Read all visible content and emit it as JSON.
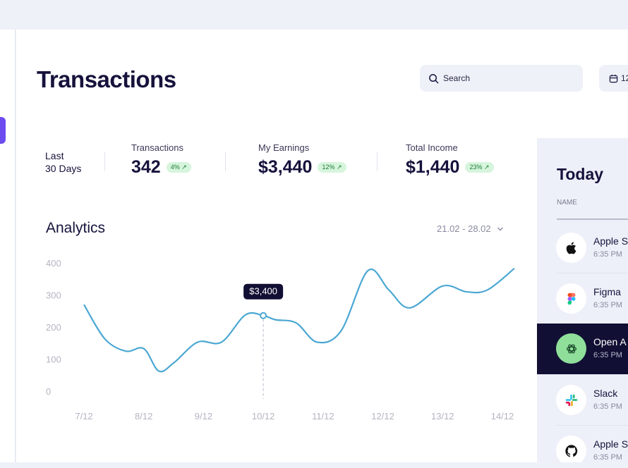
{
  "page": {
    "title": "Transactions"
  },
  "search": {
    "placeholder": "Search"
  },
  "date_filter": {
    "label": "12"
  },
  "summary": {
    "period_line1": "Last",
    "period_line2": "30 Days",
    "stats": [
      {
        "label": "Transactions",
        "value": "342",
        "badge": "4% ↗"
      },
      {
        "label": "My Earnings",
        "value": "$3,440",
        "badge": "12% ↗"
      },
      {
        "label": "Total Income",
        "value": "$1,440",
        "badge": "23% ↗"
      }
    ]
  },
  "analytics": {
    "title": "Analytics",
    "range": "21.02 - 28.02"
  },
  "chart_data": {
    "type": "line",
    "categories": [
      "7/12",
      "8/12",
      "9/12",
      "10/12",
      "11/12",
      "12/12",
      "13/12",
      "14/12"
    ],
    "y_ticks": [
      "400",
      "300",
      "200",
      "100",
      "0"
    ],
    "ylim": [
      0,
      400
    ],
    "series": [
      {
        "color": "#4aa7d2",
        "points": [
          [
            7.0,
            272
          ],
          [
            7.35,
            165
          ],
          [
            7.7,
            127
          ],
          [
            8.0,
            135
          ],
          [
            8.25,
            65
          ],
          [
            8.5,
            90
          ],
          [
            8.9,
            155
          ],
          [
            9.3,
            155
          ],
          [
            9.7,
            240
          ],
          [
            10.0,
            238
          ],
          [
            10.2,
            225
          ],
          [
            10.55,
            215
          ],
          [
            10.9,
            155
          ],
          [
            11.3,
            190
          ],
          [
            11.75,
            378
          ],
          [
            12.1,
            318
          ],
          [
            12.45,
            262
          ],
          [
            13.0,
            330
          ],
          [
            13.4,
            312
          ],
          [
            13.75,
            318
          ],
          [
            14.2,
            385
          ]
        ]
      }
    ],
    "highlight": {
      "x": 10.0,
      "y": 238,
      "label": "$3,400"
    }
  },
  "today": {
    "title": "Today",
    "column_name": "NAME",
    "items": [
      {
        "name": "Apple S",
        "time": "6:35 PM",
        "icon": "apple-icon",
        "active": false
      },
      {
        "name": "Figma",
        "time": "6:35 PM",
        "icon": "figma-icon",
        "active": false
      },
      {
        "name": "Open A",
        "time": "6:35 PM",
        "icon": "openai-icon",
        "active": true
      },
      {
        "name": "Slack",
        "time": "6:35 PM",
        "icon": "slack-icon",
        "active": false
      },
      {
        "name": "Apple S",
        "time": "6:35 PM",
        "icon": "github-icon",
        "active": false
      }
    ]
  },
  "colors": {
    "brand": "#6c4cf1",
    "line": "#4aa7d2",
    "dark": "#110f33",
    "badge_bg": "#d6f5dc",
    "panel_bg": "#edf0f8"
  }
}
